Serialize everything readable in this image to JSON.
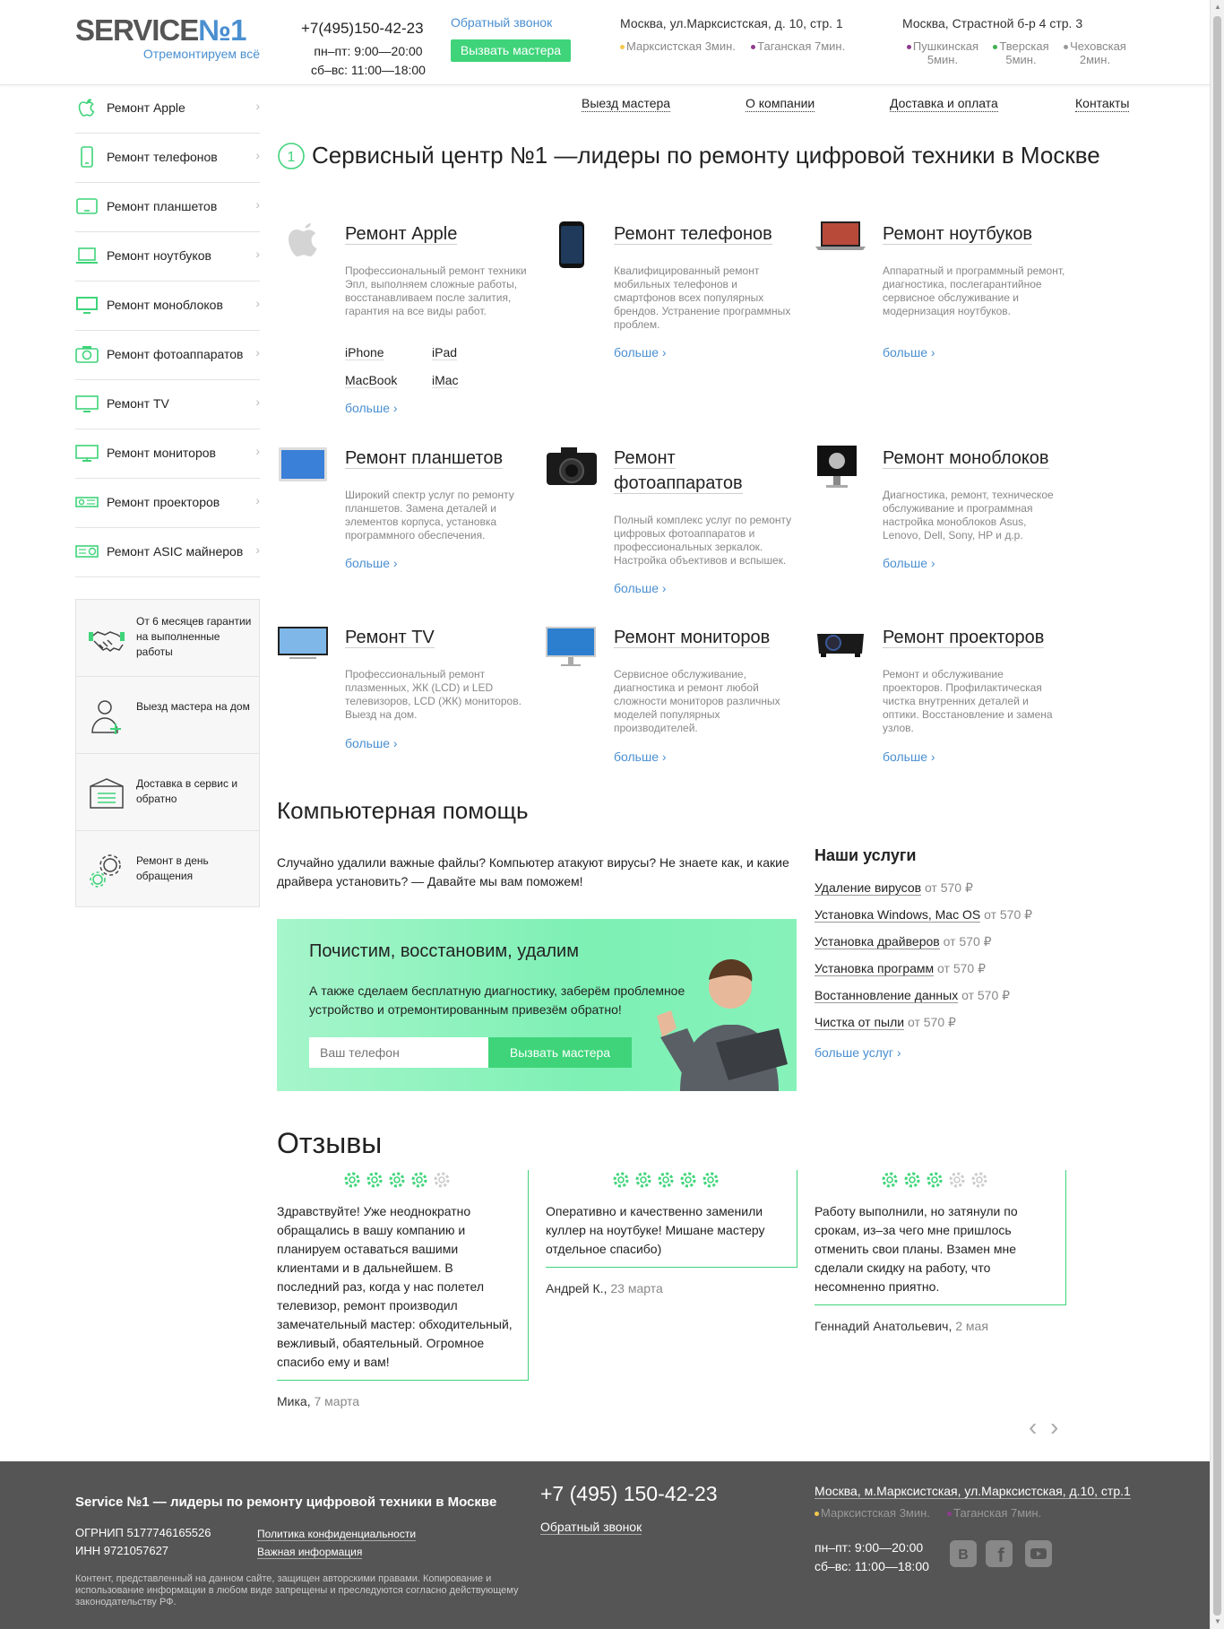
{
  "header": {
    "logo_main": "SERVICE",
    "logo_num": "№1",
    "logo_tagline": "Отремонтируем всё",
    "phone": "+7(495)150-42-23",
    "hours_weekday": "пн–пт: 9:00—20:00",
    "hours_weekend": "сб–вс: 11:00—18:00",
    "callback_label": "Обратный звонок",
    "call_master_label": "Вызвать мастера",
    "address1": "Москва, ул.Марксистская, д. 10, стр. 1",
    "address1_metro": [
      {
        "name": "Марксистская 3мин.",
        "color": "#f2c94c"
      },
      {
        "name": "Таганская 7мин.",
        "color": "#8e3c8f"
      }
    ],
    "address2": "Москва, Страстной б-р 4 стр. 3",
    "address2_metro": [
      {
        "name": "Пушкинская",
        "time": "5мин.",
        "color": "#8e3c8f"
      },
      {
        "name": "Тверская",
        "time": "5мин.",
        "color": "#3fb04f"
      },
      {
        "name": "Чеховская",
        "time": "2мин.",
        "color": "#999999"
      }
    ]
  },
  "nav": [
    "Выезд мастера",
    "О компании",
    "Доставка и оплата",
    "Контакты"
  ],
  "sidebar": {
    "items": [
      {
        "label": "Ремонт Apple",
        "icon": "apple-icon"
      },
      {
        "label": "Ремонт телефонов",
        "icon": "phone-icon"
      },
      {
        "label": "Ремонт планшетов",
        "icon": "tablet-icon"
      },
      {
        "label": "Ремонт ноутбуков",
        "icon": "laptop-icon"
      },
      {
        "label": "Ремонт моноблоков",
        "icon": "monoblock-icon"
      },
      {
        "label": "Ремонт фотоаппаратов",
        "icon": "camera-icon"
      },
      {
        "label": "Ремонт TV",
        "icon": "tv-icon"
      },
      {
        "label": "Ремонт мониторов",
        "icon": "monitor-icon"
      },
      {
        "label": "Ремонт проекторов",
        "icon": "projector-icon"
      },
      {
        "label": "Ремонт ASIC майнеров",
        "icon": "asic-icon"
      }
    ],
    "benefits": [
      {
        "text": "От 6 месяцев гарантии на выполненные работы",
        "icon": "handshake-icon"
      },
      {
        "text": "Выезд мастера на дом",
        "icon": "person-icon"
      },
      {
        "text": "Доставка в сервис и обратно",
        "icon": "box-icon"
      },
      {
        "text": "Ремонт в день обращения",
        "icon": "gears-icon"
      }
    ]
  },
  "main": {
    "title": "Сервисный центр №1 —лидеры по ремонту цифровой техники в Москве",
    "more_label": "больше",
    "services": [
      {
        "title": "Ремонт Apple",
        "desc": "Профессиональный ремонт техники Эпл, выполняем сложные работы, восстанавливаем после залития, гарантия на все виды работ.",
        "links": [
          "iPhone",
          "iPad",
          "MacBook",
          "iMac"
        ]
      },
      {
        "title": "Ремонт телефонов",
        "desc": "Квалифицированный ремонт мобильных телефонов и смартфонов всех популярных брендов. Устранение программных проблем."
      },
      {
        "title": "Ремонт ноутбуков",
        "desc": "Аппаратный и программный ремонт, диагностика, послегарантийное сервисное обслуживание и модернизация ноутбуков."
      },
      {
        "title": "Ремонт планшетов",
        "desc": "Широкий спектр услуг по ремонту планшетов. Замена деталей и элементов корпуса, установка программного обеспечения."
      },
      {
        "title": "Ремонт фотоаппаратов",
        "desc": "Полный комплекс услуг по ремонту цифровых фотоаппаратов и профессиональных зеркалок. Настройка объективов и вспышек."
      },
      {
        "title": "Ремонт моноблоков",
        "desc": "Диагностика, ремонт, техническое обслуживание и программная настройка моноблоков Asus, Lenovo, Dell, Sony, HP и д.р."
      },
      {
        "title": "Ремонт TV",
        "desc": "Профессиональный ремонт плазменных, ЖК (LCD) и LED телевизоров, LCD (ЖК) мониторов. Выезд на дом."
      },
      {
        "title": "Ремонт мониторов",
        "desc": "Сервисное обслуживание, диагностика и ремонт любой сложности мониторов различных моделей популярных производителей."
      },
      {
        "title": "Ремонт проекторов",
        "desc": "Ремонт и обслуживание проекторов. Профилактическая чистка внутренних деталей и оптики. Восстановление и замена узлов."
      }
    ]
  },
  "computer_help": {
    "title": "Компьютерная помощь",
    "intro": "Случайно удалили важные файлы? Компьютер атакуют вирусы? Не знаете как, и какие драйвера установить? — Давайте мы вам поможем!",
    "promo_title": "Почистим, восстановим, удалим",
    "promo_desc": "А также сделаем бесплатную диагностику, заберём проблемное устройство и отремонтированным привезём обратно!",
    "phone_placeholder": "Ваш телефон",
    "promo_button": "Вызвать мастера",
    "services_title": "Наши услуги",
    "services": [
      {
        "name": "Удаление вирусов",
        "price": "от 570 ₽"
      },
      {
        "name": "Установка Windows, Mac OS",
        "price": "от 570 ₽"
      },
      {
        "name": "Установка драйверов",
        "price": "от 570 ₽"
      },
      {
        "name": "Установка программ",
        "price": "от 570 ₽"
      },
      {
        "name": "Востанновление данных",
        "price": "от 570 ₽"
      },
      {
        "name": "Чистка от пыли",
        "price": "от 570 ₽"
      }
    ],
    "more_services": "больше услуг"
  },
  "reviews": {
    "title": "Отзывы",
    "items": [
      {
        "rating": 4,
        "text": "Здравствуйте! Уже неоднократно обращались в вашу компанию и планируем оставаться вашими клиентами и в дальнейшем. В последний раз, когда у нас полетел телевизор, ремонт производил замечательный мастер: обходительный, вежливый, обаятельный. Огромное спасибо ему и вам!",
        "author": "Мика,",
        "date": "7 марта"
      },
      {
        "rating": 5,
        "text": "Оперативно и качественно заменили куллер на ноутбуке! Мишане мастеру отдельное спасибо)",
        "author": "Андрей К.,",
        "date": "23 марта"
      },
      {
        "rating": 3,
        "text": "Работу выполнили, но затянули по срокам, из–за чего мне пришлось отменить свои планы. Взамен мне сделали скидку на работу, что несомненно приятно.",
        "author": "Геннадий Анатольевич,",
        "date": "2 мая"
      }
    ]
  },
  "footer": {
    "title": "Service №1 — лидеры по ремонту цифровой техники в Москве",
    "ogrn": "ОГРНИП 5177746165526",
    "inn": "ИНН 9721057627",
    "privacy": "Политика конфиденциальности",
    "important": "Важная информация",
    "copyright": "Контент, представленный на данном сайте, защищен авторскими правами. Копирование и использование информации в любом виде запрещены и преследуются согласно действующему законодательству РФ.",
    "phone": "+7 (495) 150-42-23",
    "callback": "Обратный звонок",
    "address": "Москва, м.Марксистская, ул.Марксистская, д.10, стр.1",
    "metro": [
      {
        "name": "Марксистская 3мин.",
        "color": "#f2c94c"
      },
      {
        "name": "Таганская 7мин.",
        "color": "#8e3c8f"
      }
    ],
    "hours_weekday": "пн–пт: 9:00—20:00",
    "hours_weekend": "сб–вс: 11:00—18:00",
    "social": [
      "vk-icon",
      "facebook-icon",
      "youtube-icon"
    ]
  },
  "colors": {
    "accent": "#3fd47a",
    "link": "#4a8fd0",
    "footer_bg": "#555555"
  }
}
